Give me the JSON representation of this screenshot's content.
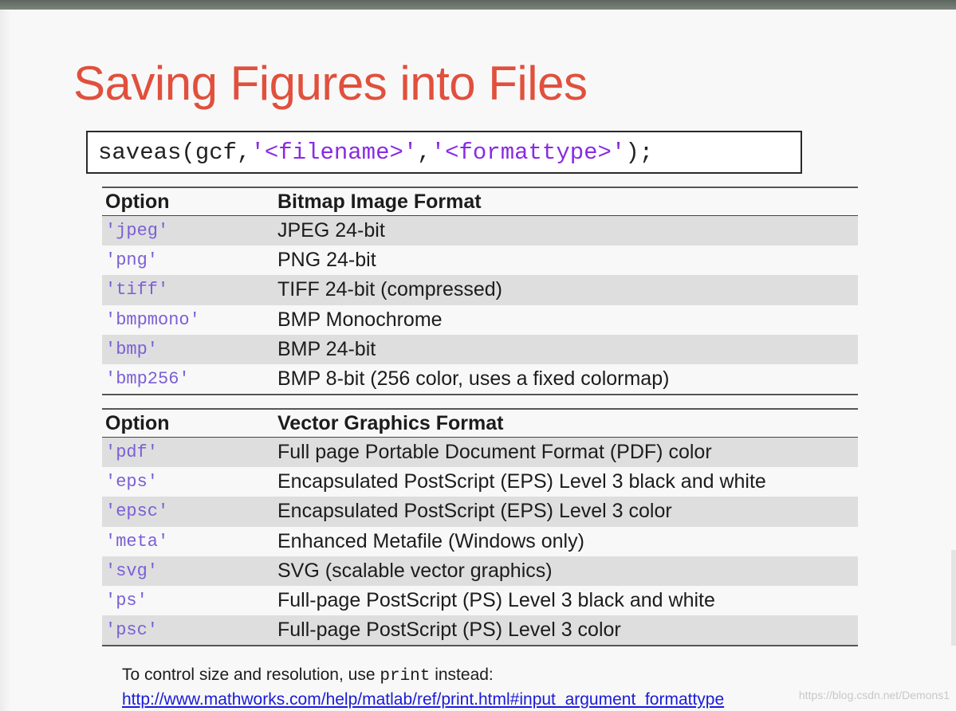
{
  "title": "Saving Figures into Files",
  "code": {
    "prefix": "saveas(gcf,",
    "arg1": "'<filename>'",
    "sep": ",",
    "arg2": "'<formattype>'",
    "suffix": ");"
  },
  "bitmap_table": {
    "header_option": "Option",
    "header_format": "Bitmap Image Format",
    "rows": [
      {
        "option": "'jpeg'",
        "format": "JPEG 24-bit"
      },
      {
        "option": "'png'",
        "format": "PNG 24-bit"
      },
      {
        "option": "'tiff'",
        "format": "TIFF 24-bit (compressed)"
      },
      {
        "option": "'bmpmono'",
        "format": "BMP Monochrome"
      },
      {
        "option": "'bmp'",
        "format": "BMP 24-bit"
      },
      {
        "option": "'bmp256'",
        "format": "BMP 8-bit (256 color, uses a fixed colormap)"
      }
    ]
  },
  "vector_table": {
    "header_option": "Option",
    "header_format": "Vector Graphics Format",
    "rows": [
      {
        "option": "'pdf'",
        "format": "Full page Portable Document Format (PDF) color"
      },
      {
        "option": "'eps'",
        "format": "Encapsulated PostScript (EPS) Level 3 black and white"
      },
      {
        "option": "'epsc'",
        "format": "Encapsulated PostScript (EPS) Level 3 color"
      },
      {
        "option": "'meta'",
        "format": "Enhanced Metafile (Windows only)"
      },
      {
        "option": "'svg'",
        "format": "SVG (scalable vector graphics)"
      },
      {
        "option": "'ps'",
        "format": "Full-page PostScript (PS) Level 3 black and white"
      },
      {
        "option": "'psc'",
        "format": "Full-page PostScript (PS) Level 3 color"
      }
    ]
  },
  "footer": {
    "text_before": "To control size and resolution, use ",
    "code_word": "print",
    "text_after": " instead:",
    "link": "http://www.mathworks.com/help/matlab/ref/print.html#input_argument_formattype"
  },
  "watermark": "https://blog.csdn.net/Demons1",
  "colors": {
    "title": "#e0503d",
    "string_literal": "#8a2be2",
    "option_text": "#7b5fd6",
    "row_shade": "#dedede",
    "link": "#1a1adb"
  }
}
